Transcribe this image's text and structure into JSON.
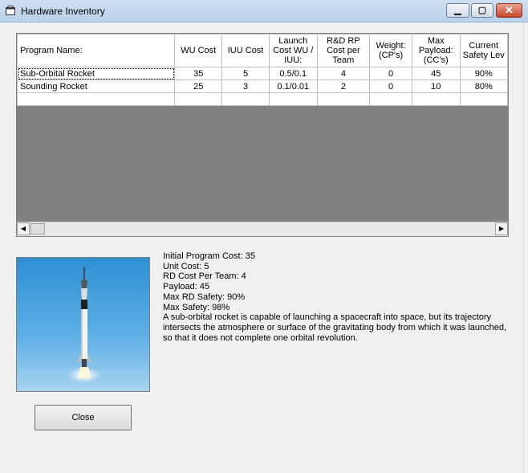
{
  "window": {
    "title": "Hardware Inventory"
  },
  "grid": {
    "columns": [
      "Program Name:",
      "WU Cost",
      "IUU Cost",
      "Launch Cost WU / IUU:",
      "R&D RP Cost per Team",
      "Weight: (CP's)",
      "Max Payload: (CC's)",
      "Current Safety Lev"
    ],
    "rows": [
      [
        "Sub-Orbital Rocket",
        "35",
        "5",
        "0.5/0.1",
        "4",
        "0",
        "45",
        "90%"
      ],
      [
        "Sounding Rocket",
        "25",
        "3",
        "0.1/0.01",
        "2",
        "0",
        "10",
        "80%"
      ]
    ]
  },
  "details": {
    "initial_cost": "Initial Program Cost: 35",
    "unit_cost": "Unit Cost: 5",
    "rd_cost": "RD Cost Per Team: 4",
    "payload": "Payload: 45",
    "max_rd_safety": "Max RD Safety: 90%",
    "max_safety": "Max Safety: 98%",
    "description": "A sub-orbital rocket is capable of launching a spacecraft into space, but its trajectory intersects the atmosphere or surface of the gravitating body from which it was launched, so that it does not complete one orbital revolution."
  },
  "buttons": {
    "close_label": "Close"
  },
  "icons": {
    "window_icon": "window-icon",
    "minimize": "minimize-icon",
    "maximize": "maximize-icon",
    "close": "close-icon"
  },
  "colors": {
    "titlebar": "#b9d1ea",
    "grid_background": "#808080",
    "close_button": "#c7472b"
  }
}
